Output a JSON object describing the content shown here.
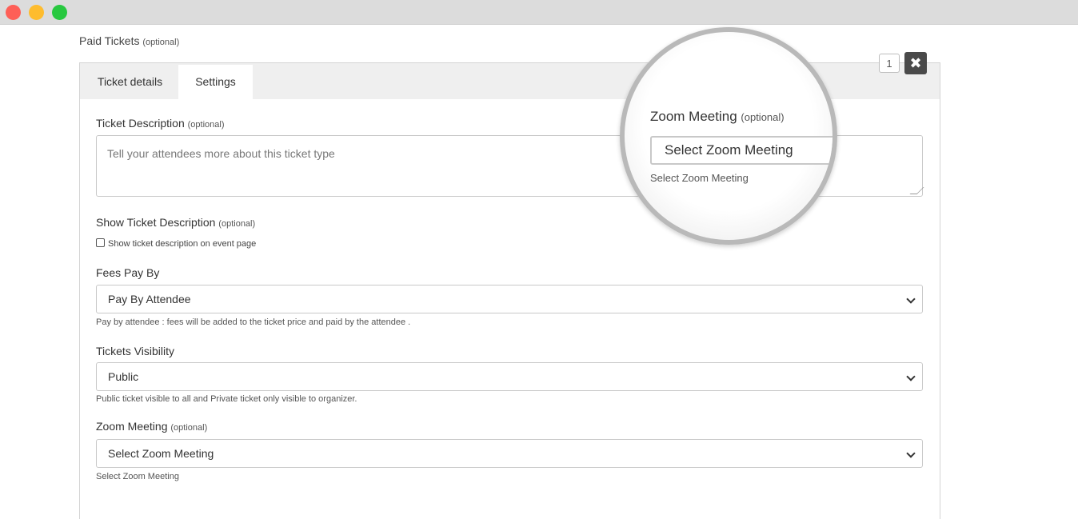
{
  "window": {
    "controls": [
      "close",
      "minimize",
      "maximize"
    ]
  },
  "section": {
    "title": "Paid Tickets",
    "optional": "(optional)"
  },
  "badge": "1",
  "close_icon": "✖",
  "tabs": [
    {
      "label": "Ticket details",
      "active": false
    },
    {
      "label": "Settings",
      "active": true
    }
  ],
  "fields": {
    "description": {
      "label": "Ticket Description",
      "optional": "(optional)",
      "placeholder": "Tell your attendees more about this ticket type"
    },
    "show_description": {
      "label": "Show Ticket Description",
      "optional": "(optional)",
      "checkbox_label": "Show ticket description on event page",
      "checked": false
    },
    "fees": {
      "label": "Fees Pay By",
      "value": "Pay By Attendee",
      "help": "Pay by attendee : fees will be added to the ticket price and paid by the attendee ."
    },
    "visibility": {
      "label": "Tickets Visibility",
      "value": "Public",
      "help": "Public ticket visible to all and Private ticket only visible to organizer."
    },
    "zoom": {
      "label": "Zoom Meeting",
      "optional": "(optional)",
      "value": "Select Zoom Meeting",
      "help": "Select Zoom Meeting"
    }
  },
  "magnifier": {
    "label": "Zoom Meeting",
    "optional": "(optional)",
    "value": "Select Zoom Meeting",
    "help": "Select Zoom Meeting"
  },
  "colors": {
    "close_red": "#fe5f57",
    "minimize_yellow": "#febc2e",
    "maximize_green": "#28c840",
    "tabbar_bg": "#efefef",
    "close_button_bg": "#4a4a4a"
  }
}
